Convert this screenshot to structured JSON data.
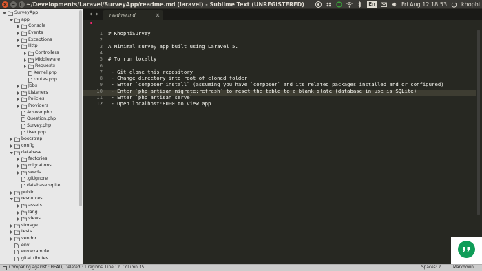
{
  "window": {
    "title": "~/Developments/Laravel/SurveyApp/readme.md (laravel) - Sublime Text (UNREGISTERED)"
  },
  "panel": {
    "lang": "En",
    "clock": "Fri Aug 12 18:53",
    "user": "khophi",
    "icons": [
      "chrome-icon",
      "dropbox-icon",
      "sync-icon",
      "wifi-icon",
      "bluetooth-icon",
      "keyboard-language-icon",
      "mail-icon",
      "volume-icon",
      "power-icon"
    ]
  },
  "sidebar": {
    "items": [
      {
        "label": "SurveyApp",
        "type": "folder-open",
        "depth": 0
      },
      {
        "label": "app",
        "type": "folder-open",
        "depth": 1
      },
      {
        "label": "Console",
        "type": "folder",
        "depth": 2
      },
      {
        "label": "Events",
        "type": "folder",
        "depth": 2
      },
      {
        "label": "Exceptions",
        "type": "folder",
        "depth": 2
      },
      {
        "label": "Http",
        "type": "folder-open",
        "depth": 2
      },
      {
        "label": "Controllers",
        "type": "folder",
        "depth": 3
      },
      {
        "label": "Middleware",
        "type": "folder",
        "depth": 3
      },
      {
        "label": "Requests",
        "type": "folder",
        "depth": 3
      },
      {
        "label": "Kernel.php",
        "type": "file",
        "depth": 3
      },
      {
        "label": "routes.php",
        "type": "file",
        "depth": 3
      },
      {
        "label": "Jobs",
        "type": "folder",
        "depth": 2
      },
      {
        "label": "Listeners",
        "type": "folder",
        "depth": 2
      },
      {
        "label": "Policies",
        "type": "folder",
        "depth": 2
      },
      {
        "label": "Providers",
        "type": "folder",
        "depth": 2
      },
      {
        "label": "Answer.php",
        "type": "file",
        "depth": 2
      },
      {
        "label": "Question.php",
        "type": "file",
        "depth": 2
      },
      {
        "label": "Survey.php",
        "type": "file",
        "depth": 2
      },
      {
        "label": "User.php",
        "type": "file",
        "depth": 2
      },
      {
        "label": "bootstrap",
        "type": "folder",
        "depth": 1
      },
      {
        "label": "config",
        "type": "folder",
        "depth": 1
      },
      {
        "label": "database",
        "type": "folder-open",
        "depth": 1
      },
      {
        "label": "factories",
        "type": "folder",
        "depth": 2
      },
      {
        "label": "migrations",
        "type": "folder",
        "depth": 2
      },
      {
        "label": "seeds",
        "type": "folder",
        "depth": 2
      },
      {
        "label": ".gitignore",
        "type": "file",
        "depth": 2
      },
      {
        "label": "database.sqlite",
        "type": "file",
        "depth": 2
      },
      {
        "label": "public",
        "type": "folder",
        "depth": 1
      },
      {
        "label": "resources",
        "type": "folder-open",
        "depth": 1
      },
      {
        "label": "assets",
        "type": "folder",
        "depth": 2
      },
      {
        "label": "lang",
        "type": "folder",
        "depth": 2
      },
      {
        "label": "views",
        "type": "folder",
        "depth": 2
      },
      {
        "label": "storage",
        "type": "folder",
        "depth": 1
      },
      {
        "label": "tests",
        "type": "folder",
        "depth": 1
      },
      {
        "label": "vendor",
        "type": "folder",
        "depth": 1
      },
      {
        "label": ".env",
        "type": "file",
        "depth": 1
      },
      {
        "label": ".env.example",
        "type": "file",
        "depth": 1
      },
      {
        "label": ".gitattributes",
        "type": "file",
        "depth": 1
      }
    ]
  },
  "tabs": [
    {
      "label": "readme.md",
      "active": true
    }
  ],
  "editor": {
    "current_line": 12,
    "lines": [
      {
        "n": "1",
        "text": "# KhophiSurvey"
      },
      {
        "n": "2",
        "text": ""
      },
      {
        "n": "3",
        "text": "A Minimal survey app built using Laravel 5."
      },
      {
        "n": "4",
        "text": ""
      },
      {
        "n": "5",
        "text": "# To run locally"
      },
      {
        "n": "6",
        "text": ""
      },
      {
        "n": "7",
        "text": " - Git clone this repository"
      },
      {
        "n": "8",
        "text": " - Change directory into root of cloned folder"
      },
      {
        "n": "9",
        "text": " - Enter `composer install` (assuming you have `composer` and its related packages installed and or configured)"
      },
      {
        "n": "10",
        "text": " - Enter `php artisan migrate:refresh` to reset the table to a blank slate (database in use is SQLite)"
      },
      {
        "n": "11",
        "text": " - Enter `php artisan serve`"
      },
      {
        "n": "12",
        "text": " - Open localhost:8000 to view app"
      }
    ]
  },
  "statusbar": {
    "git": "Comparing against : HEAD, Deleted : 1 regions, Line 12, Column 35",
    "spaces": "Spaces: 2",
    "syntax": "Markdown"
  }
}
